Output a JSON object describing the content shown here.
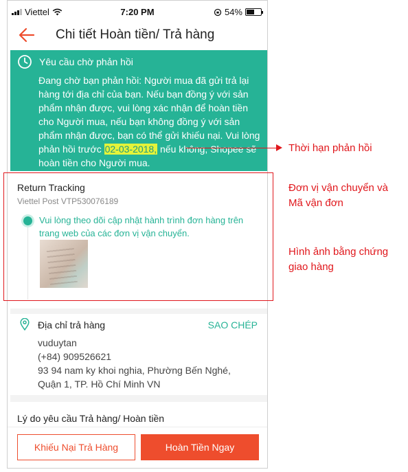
{
  "status_bar": {
    "carrier": "Viettel",
    "time": "7:20 PM",
    "battery": "54%"
  },
  "nav": {
    "title": "Chi tiết Hoàn tiền/ Trả hàng"
  },
  "notice": {
    "title": "Yêu cầu chờ phản hồi",
    "body_before": "Đang chờ bạn phản hồi: Người mua đã gửi trả lại hàng tới địa chỉ của bạn. Nếu bạn đồng ý với sản phẩm nhận được, vui lòng xác nhận để hoàn tiền cho Người mua, nếu bạn không đồng ý với sản phẩm nhận được, bạn có thể gửi khiếu nại. Vui lòng phản hồi trước",
    "deadline": "02-03-2018,",
    "body_after": "nếu không, Shopee sẽ hoàn tiền cho Người mua."
  },
  "tracking": {
    "title": "Return Tracking",
    "carrier_code": "Viettel Post VTP530076189",
    "message": "Vui lòng theo dõi cập nhật hành trình đơn hàng trên trang web của các đơn vị vận chuyển."
  },
  "address": {
    "title": "Địa chỉ trả hàng",
    "copy_label": "SAO CHÉP",
    "name": "vuduytan",
    "phone": "(+84) 909526621",
    "line1": "93 94 nam ky khoi nghia, Phường Bến Nghé,",
    "line2": "Quận 1, TP. Hồ Chí Minh VN"
  },
  "reason_label": "Lý do yêu cầu Trả hàng/ Hoàn tiền",
  "buttons": {
    "dispute": "Khiếu Nại Trả Hàng",
    "refund": "Hoàn Tiền Ngay"
  },
  "annotations": {
    "deadline": "Thời hạn phản hồi",
    "carrier_line1": "Đơn vị vận chuyển và",
    "carrier_line2": "Mã vận đơn",
    "proof_line1": "Hình ảnh bằng chứng",
    "proof_line2": "giao hàng"
  },
  "colors": {
    "accent": "#ee4d2d",
    "teal": "#26b396",
    "highlight": "#e4f33a",
    "annotation": "#e0161b"
  }
}
